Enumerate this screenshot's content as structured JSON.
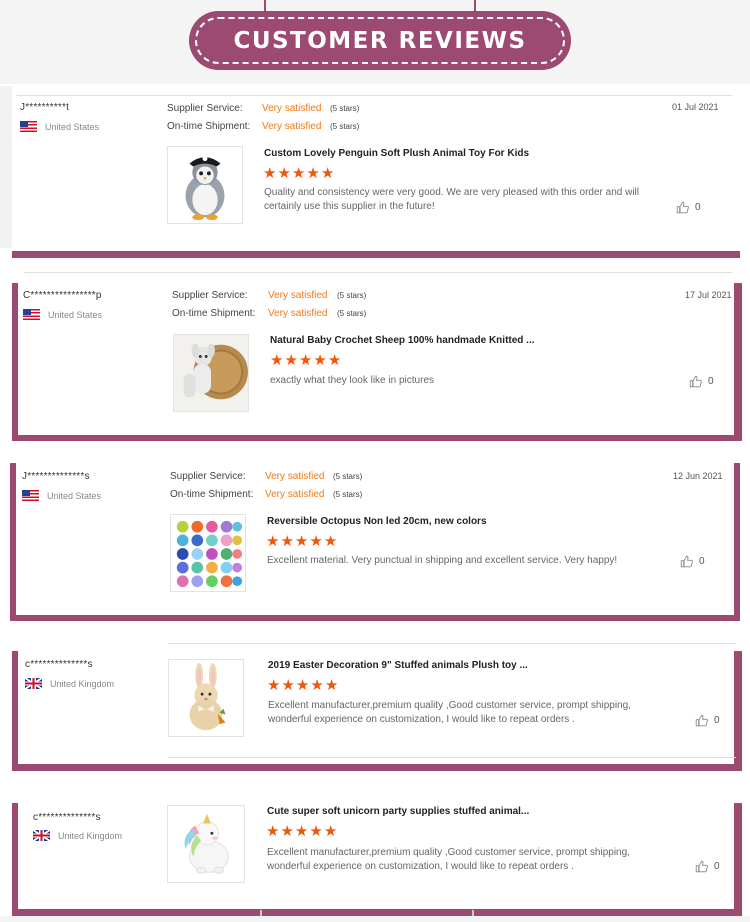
{
  "banner": {
    "title": "CUSTOMER REVIEWS"
  },
  "labels": {
    "supplier_service": "Supplier Service:",
    "ontime_shipment": "On-time Shipment:"
  },
  "colors": {
    "brand": "#9c4a72",
    "accent": "#f07a12",
    "star": "#f2560a"
  },
  "reviews": [
    {
      "reviewer": "J**********t",
      "country": "United States",
      "flag": "us-flag",
      "supplier_service": "Very satisfied",
      "supplier_service_stars": "(5 stars)",
      "ontime_shipment": "Very satisfied",
      "ontime_shipment_stars": "(5 stars)",
      "date": "01 Jul 2021",
      "product": "Custom Lovely Penguin Soft Plush Animal Toy For Kids",
      "rating": 5,
      "text": "Quality and consistency were very good.  We are very pleased with this order and will certainly use this supplier in the future!",
      "likes": "0"
    },
    {
      "reviewer": "C****************p",
      "country": "United States",
      "flag": "us-flag",
      "supplier_service": "Very satisfied",
      "supplier_service_stars": "(5 stars)",
      "ontime_shipment": "Very satisfied",
      "ontime_shipment_stars": "(5 stars)",
      "date": "17 Jul 2021",
      "product": "Natural Baby Crochet Sheep 100% handmade Knitted ...",
      "rating": 5,
      "text": "exactly what they look like in pictures",
      "likes": "0"
    },
    {
      "reviewer": "J**************s",
      "country": "United States",
      "flag": "us-flag",
      "supplier_service": "Very satisfied",
      "supplier_service_stars": "(5 stars)",
      "ontime_shipment": "Very satisfied",
      "ontime_shipment_stars": "(5 stars)",
      "date": "12 Jun 2021",
      "product": "Reversible Octopus Non led 20cm, new colors",
      "rating": 5,
      "text": "Excellent material.  Very punctual in shipping and excellent service.  Very happy!",
      "likes": "0"
    },
    {
      "reviewer": "c**************s",
      "country": "United Kingdom",
      "flag": "uk-flag",
      "product": "2019 Easter Decoration 9\" Stuffed animals Plush toy ...",
      "rating": 5,
      "text": "Excellent manufacturer,premium quality ,Good customer service, prompt shipping, wonderful experience on customization, I would like to repeat orders .",
      "likes": "0"
    },
    {
      "reviewer": "c**************s",
      "country": "United Kingdom",
      "flag": "uk-flag",
      "product": "Cute super soft unicorn party supplies stuffed animal...",
      "rating": 5,
      "text": "Excellent manufacturer,premium quality ,Good customer service, prompt shipping, wonderful experience on customization, I would like to repeat orders .",
      "likes": "0"
    }
  ]
}
